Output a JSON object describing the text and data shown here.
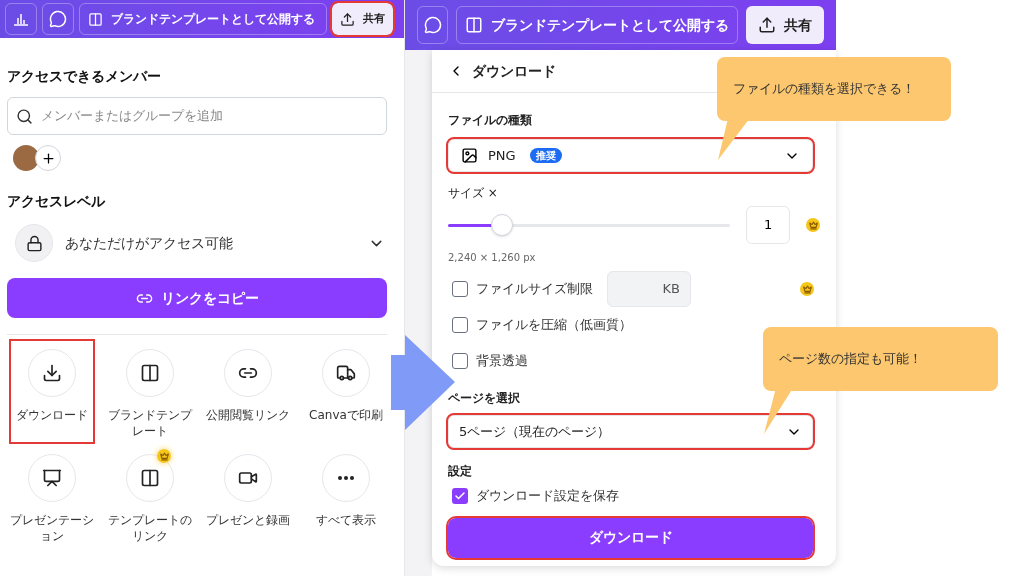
{
  "left_screen": {
    "toolbar": {
      "brand_button": "ブランドテンプレートとして公開する",
      "share_button": {
        "label": "共有",
        "highlighted": true
      }
    },
    "members_heading": "アクセスできるメンバー",
    "member_search": {
      "placeholder": "メンバーまたはグループを追加"
    },
    "access_heading": "アクセスレベル",
    "access_level": "あなただけがアクセス可能",
    "copy_link_button": "リンクをコピー",
    "actions": [
      {
        "label": "ダウンロード",
        "highlighted": true,
        "premium": false
      },
      {
        "label": "ブランドテンプレート",
        "highlighted": false,
        "premium": false
      },
      {
        "label": "公開閲覧リンク",
        "highlighted": false,
        "premium": false
      },
      {
        "label": "Canvaで印刷",
        "highlighted": false,
        "premium": false
      },
      {
        "label": "プレゼンテーション",
        "highlighted": false,
        "premium": false
      },
      {
        "label": "テンプレートのリンク",
        "highlighted": false,
        "premium": true
      },
      {
        "label": "プレゼンと録画",
        "highlighted": false,
        "premium": false
      },
      {
        "label": "すべて表示",
        "highlighted": false,
        "premium": false
      }
    ]
  },
  "right_screen": {
    "toolbar": {
      "brand_button": "ブランドテンプレートとして公開する",
      "share_button": {
        "label": "共有",
        "highlighted": false
      }
    },
    "panel_title": "ダウンロード",
    "file_type_label": "ファイルの種類",
    "file_type": {
      "value": "PNG",
      "badge": "推奨",
      "highlighted": true
    },
    "size_label": "サイズ ×",
    "size": {
      "level": 0.19,
      "value": "1"
    },
    "dimensions": "2,240 × 1,260 px",
    "options": [
      {
        "kind": "limit",
        "label": "ファイルサイズ制限",
        "checked": false,
        "unit": "KB"
      },
      {
        "kind": "plain",
        "label": "ファイルを圧縮（低画質）",
        "checked": false
      },
      {
        "kind": "plain",
        "label": "背景透過",
        "checked": false
      }
    ],
    "pages_label": "ページを選択",
    "pages": {
      "value": "5ページ（現在のページ）",
      "highlighted": true
    },
    "settings_label": "設定",
    "save_settings": {
      "label": "ダウンロード設定を保存",
      "checked": true
    },
    "download_button": {
      "label": "ダウンロード",
      "highlighted": true
    }
  },
  "callouts": [
    {
      "text": "ファイルの種類を選択できる！"
    },
    {
      "text": "ページ数の指定も可能！"
    }
  ]
}
